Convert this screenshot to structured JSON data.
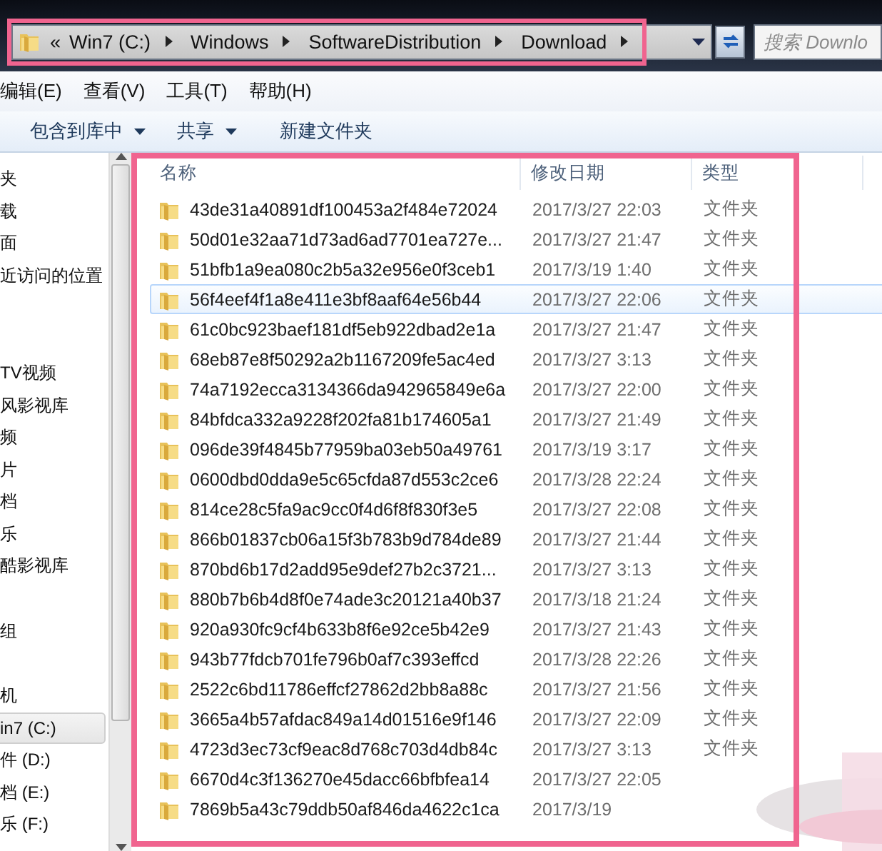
{
  "address_bar": {
    "overflow_mark": "«",
    "segments": [
      "Win7 (C:)",
      "Windows",
      "SoftwareDistribution",
      "Download"
    ],
    "highlighted": true
  },
  "search": {
    "placeholder": "搜索 Downlo"
  },
  "menu": [
    "编辑(E)",
    "查看(V)",
    "工具(T)",
    "帮助(H)"
  ],
  "toolbar": [
    {
      "label": "包含到库中",
      "dropdown": true
    },
    {
      "label": "共享",
      "dropdown": true
    },
    {
      "label": "新建文件夹",
      "dropdown": false
    }
  ],
  "nav": {
    "groups": [
      {
        "items": [
          {
            "label": "夹",
            "selected": false
          },
          {
            "label": "载",
            "selected": false
          },
          {
            "label": "面",
            "selected": false
          },
          {
            "label": "近访问的位置",
            "selected": false
          }
        ]
      },
      {
        "items": [
          {
            "label": "TV视频",
            "selected": false
          },
          {
            "label": "风影视库",
            "selected": false
          },
          {
            "label": "频",
            "selected": false
          },
          {
            "label": "片",
            "selected": false
          },
          {
            "label": "档",
            "selected": false
          },
          {
            "label": "乐",
            "selected": false
          },
          {
            "label": "酷影视库",
            "selected": false
          }
        ]
      },
      {
        "items": [
          {
            "label": "组",
            "selected": false
          }
        ]
      },
      {
        "items": [
          {
            "label": "机",
            "selected": false
          },
          {
            "label": "in7 (C:)",
            "selected": true
          },
          {
            "label": "件 (D:)",
            "selected": false
          },
          {
            "label": "档 (E:)",
            "selected": false
          },
          {
            "label": "乐 (F:)",
            "selected": false
          }
        ]
      }
    ]
  },
  "files": {
    "highlighted": true,
    "columns": [
      "名称",
      "修改日期",
      "类型"
    ],
    "rows": [
      {
        "name": "43de31a40891df100453a2f484e72024",
        "date": "2017/3/27 22:03",
        "type": "文件夹",
        "selected": false
      },
      {
        "name": "50d01e32aa71d73ad6ad7701ea727e...",
        "date": "2017/3/27 21:47",
        "type": "文件夹",
        "selected": false
      },
      {
        "name": "51bfb1a9ea080c2b5a32e956e0f3ceb1",
        "date": "2017/3/19 1:40",
        "type": "文件夹",
        "selected": false
      },
      {
        "name": "56f4eef4f1a8e411e3bf8aaf64e56b44",
        "date": "2017/3/27 22:06",
        "type": "文件夹",
        "selected": true
      },
      {
        "name": "61c0bc923baef181df5eb922dbad2e1a",
        "date": "2017/3/27 21:47",
        "type": "文件夹",
        "selected": false
      },
      {
        "name": "68eb87e8f50292a2b1167209fe5ac4ed",
        "date": "2017/3/27 3:13",
        "type": "文件夹",
        "selected": false
      },
      {
        "name": "74a7192ecca3134366da942965849e6a",
        "date": "2017/3/27 22:00",
        "type": "文件夹",
        "selected": false
      },
      {
        "name": "84bfdca332a9228f202fa81b174605a1",
        "date": "2017/3/27 21:49",
        "type": "文件夹",
        "selected": false
      },
      {
        "name": "096de39f4845b77959ba03eb50a49761",
        "date": "2017/3/19 3:17",
        "type": "文件夹",
        "selected": false
      },
      {
        "name": "0600dbd0dda9e5c65cfda87d553c2ce6",
        "date": "2017/3/28 22:24",
        "type": "文件夹",
        "selected": false
      },
      {
        "name": "814ce28c5fa9ac9cc0f4d6f8f830f3e5",
        "date": "2017/3/27 22:08",
        "type": "文件夹",
        "selected": false
      },
      {
        "name": "866b01837cb06a15f3b783b9d784de89",
        "date": "2017/3/27 21:44",
        "type": "文件夹",
        "selected": false
      },
      {
        "name": "870bd6b17d2add95e9def27b2c3721...",
        "date": "2017/3/27 3:13",
        "type": "文件夹",
        "selected": false
      },
      {
        "name": "880b7b6b4d8f0e74ade3c20121a40b37",
        "date": "2017/3/18 21:24",
        "type": "文件夹",
        "selected": false
      },
      {
        "name": "920a930fc9cf4b633b8f6e92ce5b42e9",
        "date": "2017/3/27 21:43",
        "type": "文件夹",
        "selected": false
      },
      {
        "name": "943b77fdcb701fe796b0af7c393effcd",
        "date": "2017/3/28 22:26",
        "type": "文件夹",
        "selected": false
      },
      {
        "name": "2522c6bd11786effcf27862d2bb8a88c",
        "date": "2017/3/27 21:56",
        "type": "文件夹",
        "selected": false
      },
      {
        "name": "3665a4b57afdac849a14d01516e9f146",
        "date": "2017/3/27 22:09",
        "type": "文件夹",
        "selected": false
      },
      {
        "name": "4723d3ec73cf9eac8d768c703d4db84c",
        "date": "2017/3/27 3:13",
        "type": "文件夹",
        "selected": false
      },
      {
        "name": "6670d4c3f136270e45dacc66bfbfea14",
        "date": "2017/3/27 22:05",
        "selected": false
      },
      {
        "name": "7869b5a43c79ddb50af846da4622c1ca",
        "date": "2017/3/19",
        "selected": false
      }
    ]
  }
}
